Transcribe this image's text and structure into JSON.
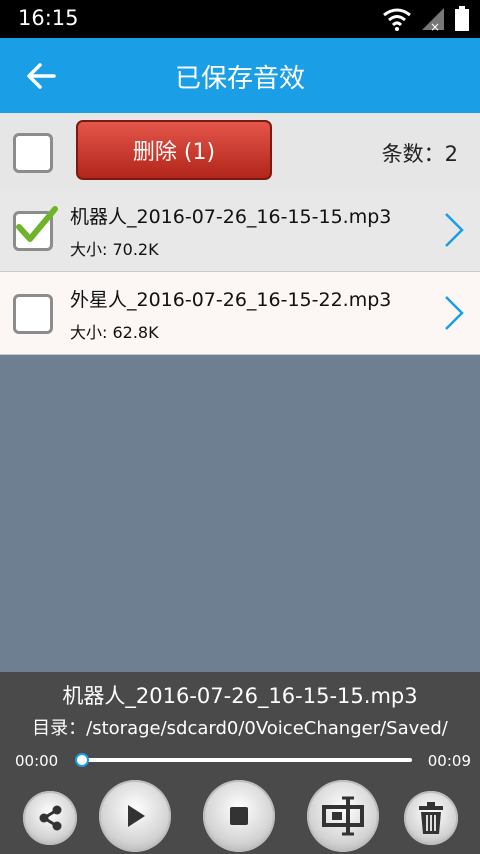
{
  "status_bar": {
    "time": "16:15"
  },
  "app_bar": {
    "title": "已保存音效"
  },
  "toolbar": {
    "delete_label": "删除 (1)",
    "count_label": "条数：2"
  },
  "files": [
    {
      "name": "机器人_2016-07-26_16-15-15.mp3",
      "size": "大小: 70.2K",
      "checked": true
    },
    {
      "name": "外星人_2016-07-26_16-15-22.mp3",
      "size": "大小: 62.8K",
      "checked": false
    }
  ],
  "player": {
    "now_playing": "机器人_2016-07-26_16-15-15.mp3",
    "directory": "目录：/storage/sdcard0/0VoiceChanger/Saved/",
    "current_time": "00:00",
    "total_time": "00:09",
    "progress": 0
  },
  "colors": {
    "accent": "#1a9ee6",
    "delete": "#c4362b",
    "list_bg": "#6e7f91",
    "player_bg": "#4a4a4a"
  },
  "icons": [
    "back-arrow-icon",
    "wifi-icon",
    "signal-icon",
    "battery-icon",
    "checkmark-icon",
    "chevron-right-icon",
    "share-icon",
    "play-icon",
    "stop-icon",
    "crop-icon",
    "trash-icon"
  ]
}
